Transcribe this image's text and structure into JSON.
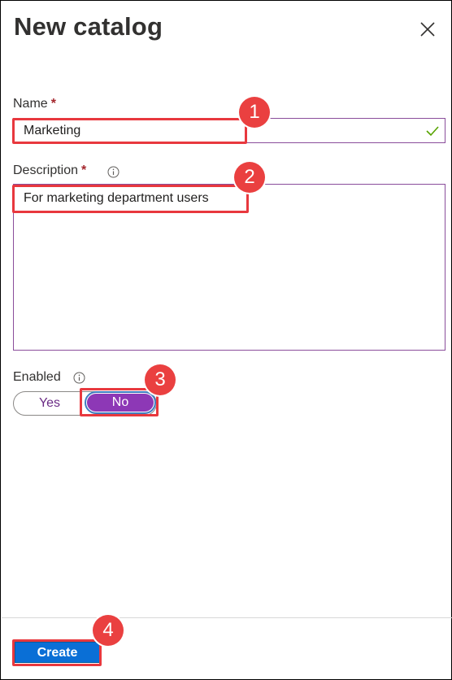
{
  "panel": {
    "title": "New catalog"
  },
  "fields": {
    "name": {
      "label": "Name",
      "required_mark": "*",
      "value": "Marketing"
    },
    "description": {
      "label": "Description",
      "required_mark": "*",
      "value": "For marketing department users"
    },
    "enabled": {
      "label": "Enabled",
      "options": [
        "Yes",
        "No"
      ],
      "selected": "No"
    }
  },
  "footer": {
    "create_label": "Create"
  },
  "callouts": [
    "1",
    "2",
    "3",
    "4"
  ],
  "colors": {
    "accent_purple": "#8d38b6",
    "input_border": "#8a4d9b",
    "primary_button": "#0a6fd6",
    "highlight_red": "#e8383e",
    "valid_check": "#57a300"
  },
  "icons": {
    "close": "close-icon",
    "info": "info-icon",
    "check": "check-icon"
  }
}
